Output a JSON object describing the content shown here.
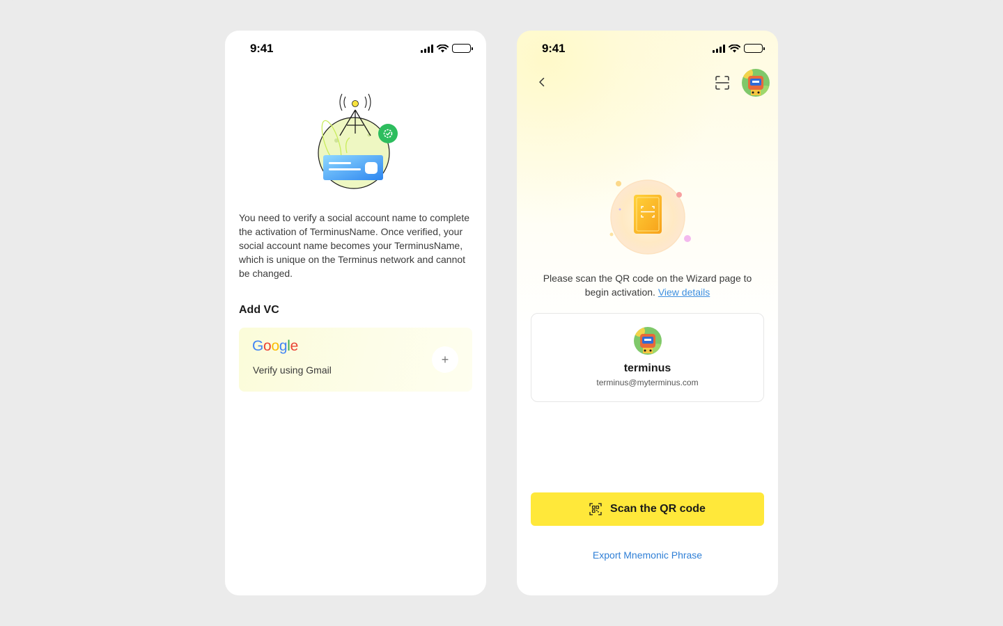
{
  "left_screen": {
    "status": {
      "time": "9:41"
    },
    "intro_text": "You need to verify a social account name to complete the activation of TerminusName. Once verified, your social account name becomes your TerminusName, which is unique on the Terminus network and cannot be changed.",
    "section_title": "Add VC",
    "vc_card": {
      "provider_logo": [
        "G",
        "o",
        "o",
        "g",
        "l",
        "e"
      ],
      "provider_colors": [
        "#4285F4",
        "#EA4335",
        "#FBBC05",
        "#4285F4",
        "#34A853",
        "#EA4335"
      ],
      "label": "Verify using Gmail",
      "add_icon": "plus-icon",
      "add_symbol": "+"
    }
  },
  "right_screen": {
    "status": {
      "time": "9:41"
    },
    "scan_hint": "Please scan the QR code on the Wizard page to begin activation.",
    "view_details": "View details",
    "user": {
      "name": "terminus",
      "email": "terminus@myterminus.com"
    },
    "scan_button_label": "Scan the QR code",
    "export_label": "Export Mnemonic Phrase"
  },
  "colors": {
    "accent_yellow": "#ffe83a",
    "link_blue": "#2f7fd6",
    "verified_green": "#2dbd5e"
  }
}
